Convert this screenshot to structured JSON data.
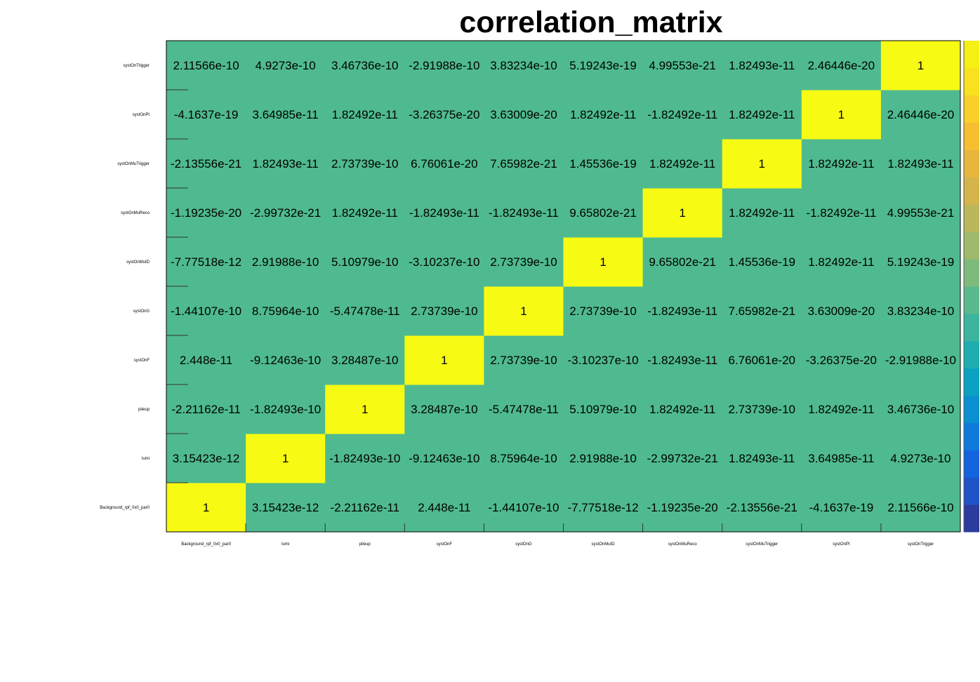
{
  "chart_data": {
    "type": "heatmap",
    "title": "correlation_matrix",
    "colors": {
      "on_diagonal": "#f7fb14",
      "off_diagonal": "#4fba8f"
    },
    "x_labels": [
      "Background_rpf_0x0_par0",
      "lumi",
      "pileup",
      "systOnF",
      "systOnG",
      "systOnMuID",
      "systOnMuReco",
      "systOnMuTrigger",
      "systOnPt",
      "systOnTrigger"
    ],
    "y_labels": [
      "Background_rpf_0x0_par0",
      "lumi",
      "pileup",
      "systOnF",
      "systOnG",
      "systOnMuID",
      "systOnMuReco",
      "systOnMuTrigger",
      "systOnPt",
      "systOnTrigger"
    ],
    "values": [
      [
        "1",
        "3.15423e-12",
        "-2.21162e-11",
        "2.448e-11",
        "-1.44107e-10",
        "-7.77518e-12",
        "-1.19235e-20",
        "-2.13556e-21",
        "-4.1637e-19",
        "2.11566e-10"
      ],
      [
        "3.15423e-12",
        "1",
        "-1.82493e-10",
        "-9.12463e-10",
        "8.75964e-10",
        "2.91988e-10",
        "-2.99732e-21",
        "1.82493e-11",
        "3.64985e-11",
        "4.9273e-10"
      ],
      [
        "-2.21162e-11",
        "-1.82493e-10",
        "1",
        "3.28487e-10",
        "-5.47478e-11",
        "5.10979e-10",
        "1.82492e-11",
        "2.73739e-10",
        "1.82492e-11",
        "3.46736e-10"
      ],
      [
        "2.448e-11",
        "-9.12463e-10",
        "3.28487e-10",
        "1",
        "2.73739e-10",
        "-3.10237e-10",
        "-1.82493e-11",
        "6.76061e-20",
        "-3.26375e-20",
        "-2.91988e-10"
      ],
      [
        "-1.44107e-10",
        "8.75964e-10",
        "-5.47478e-11",
        "2.73739e-10",
        "1",
        "2.73739e-10",
        "-1.82493e-11",
        "7.65982e-21",
        "3.63009e-20",
        "3.83234e-10"
      ],
      [
        "-7.77518e-12",
        "2.91988e-10",
        "5.10979e-10",
        "-3.10237e-10",
        "2.73739e-10",
        "1",
        "9.65802e-21",
        "1.45536e-19",
        "1.82492e-11",
        "5.19243e-19"
      ],
      [
        "-1.19235e-20",
        "-2.99732e-21",
        "1.82492e-11",
        "-1.82493e-11",
        "-1.82493e-11",
        "9.65802e-21",
        "1",
        "1.82492e-11",
        "-1.82492e-11",
        "4.99553e-21"
      ],
      [
        "-2.13556e-21",
        "1.82493e-11",
        "2.73739e-10",
        "6.76061e-20",
        "7.65982e-21",
        "1.45536e-19",
        "1.82492e-11",
        "1",
        "1.82492e-11",
        "1.82493e-11"
      ],
      [
        "-4.1637e-19",
        "3.64985e-11",
        "1.82492e-11",
        "-3.26375e-20",
        "3.63009e-20",
        "1.82492e-11",
        "-1.82492e-11",
        "1.82492e-11",
        "1",
        "2.46446e-20"
      ],
      [
        "2.11566e-10",
        "4.9273e-10",
        "3.46736e-10",
        "-2.91988e-10",
        "3.83234e-10",
        "5.19243e-19",
        "4.99553e-21",
        "1.82493e-11",
        "2.46446e-20",
        "1"
      ]
    ],
    "palette": [
      "#2b3c9e",
      "#1f53c8",
      "#1464df",
      "#0e7bdc",
      "#0a8fd0",
      "#0aa1c2",
      "#20adb0",
      "#3db59e",
      "#5ab98d",
      "#7fba7d",
      "#9fba6b",
      "#bcb75b",
      "#d4b54b",
      "#e8b63d",
      "#f6be31",
      "#f9cf2a",
      "#f9e120",
      "#f7f014"
    ]
  }
}
